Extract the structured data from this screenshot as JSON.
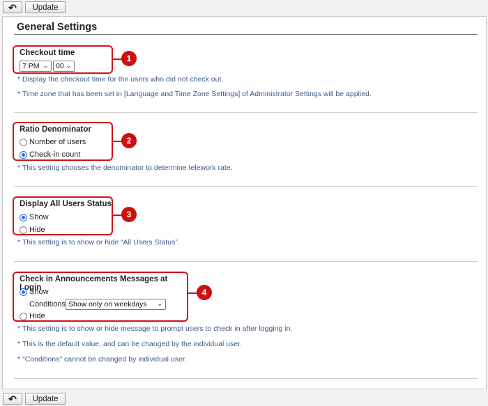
{
  "toolbar": {
    "back_icon": "back-arrow-icon",
    "back_glyph": "↶",
    "update_label": "Update"
  },
  "page": {
    "title": "General Settings"
  },
  "sections": {
    "checkout": {
      "badge": "1",
      "title": "Checkout time",
      "hour": "7 PM",
      "minute": "00",
      "notes": [
        "* Display the checkout time for the users who did not check out.",
        "* Time zone that has been set in [Language and Time Zone Settings] of Administrator Settings will be applied."
      ]
    },
    "ratio": {
      "badge": "2",
      "title": "Ratio Denominator",
      "options": [
        "Number of users",
        "Check-in count"
      ],
      "selected_index": 1,
      "note": "* This setting chooses the denominator to determine telework rate."
    },
    "all_users": {
      "badge": "3",
      "title": "Display All Users Status",
      "options": [
        "Show",
        "Hide"
      ],
      "selected_index": 0,
      "note": "* This setting is to show or hide “All Users Status”."
    },
    "announcements": {
      "badge": "4",
      "title": "Check in Announcements Messages at Login",
      "show_label": "Show",
      "conditions_label": "Conditions:",
      "conditions_value": "Show only on weekdays",
      "hide_label": "Hide",
      "selected": "show",
      "notes": [
        "* This setting is to show or hide message to prompt users to check in after logging in.",
        "* This is the default value, and can be changed by the individual user.",
        "* \"Conditions\" cannot be changed by individual user."
      ]
    }
  },
  "colors": {
    "highlight_border": "#d0121b",
    "badge": "#cc1010",
    "note_text": "#3d5a8a",
    "radio_selected": "#2b6fd6"
  }
}
